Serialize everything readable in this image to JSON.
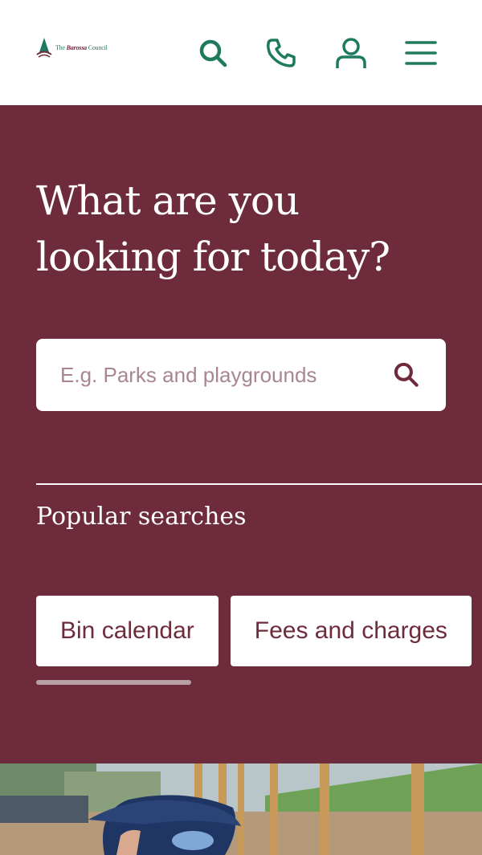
{
  "header": {
    "logo": {
      "text_pre": "The ",
      "text_brand": "Barossa",
      "text_post": " Council",
      "icon": "tree-logo-icon"
    },
    "icons": [
      "search-icon",
      "phone-icon",
      "user-icon",
      "menu-icon"
    ],
    "accent_color": "#1e7a5e"
  },
  "hero": {
    "background_color": "#6e2b3c",
    "title_line1": "What are you",
    "title_line2": "looking for today?",
    "search": {
      "placeholder": "E.g. Parks and playgrounds",
      "value": ""
    },
    "popular_heading": "Popular searches",
    "popular_chips": [
      "Bin calendar",
      "Fees and charges"
    ]
  },
  "photo": {
    "description_icon": "photo-icon"
  }
}
